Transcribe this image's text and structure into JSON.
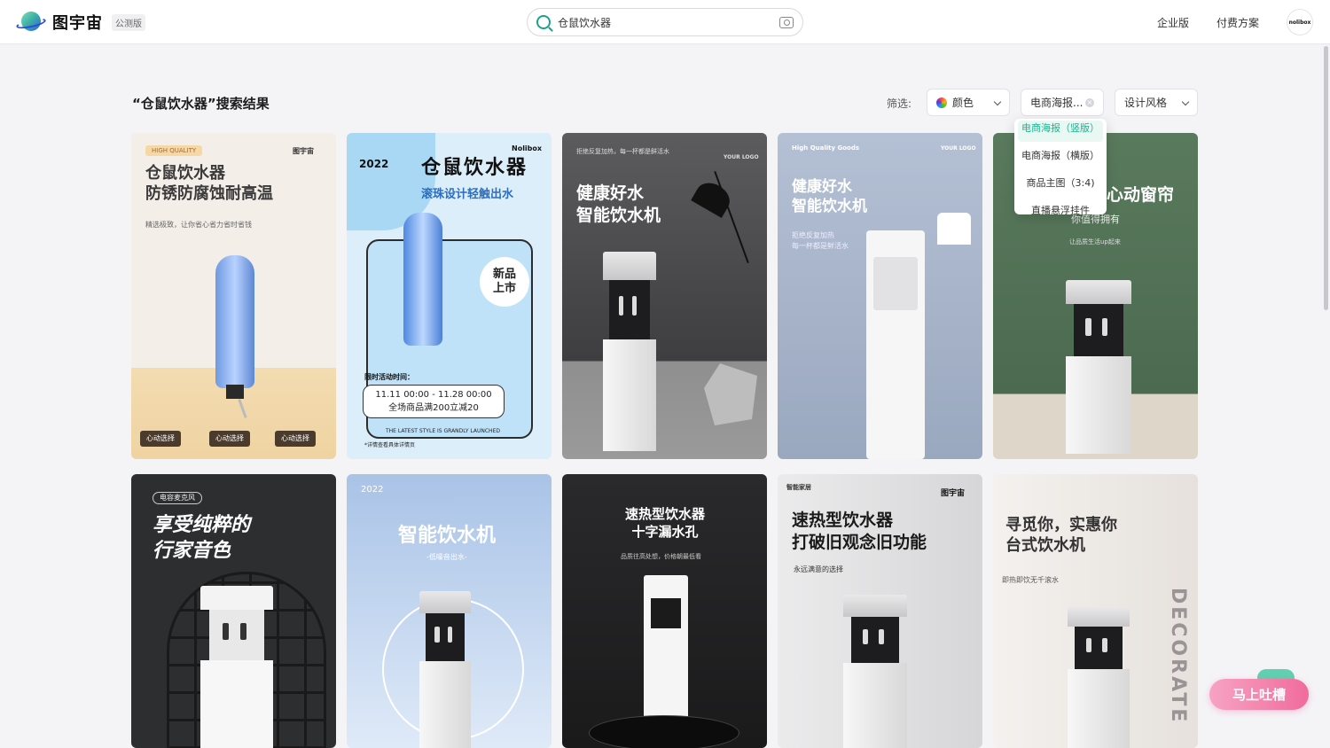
{
  "header": {
    "logo_text": "图宇宙",
    "badge": "公测版",
    "search_value": "仓鼠饮水器",
    "links": [
      "企业版",
      "付费方案"
    ],
    "avatar_text": "nolibox"
  },
  "results": {
    "title": "“仓鼠饮水器”搜索结果",
    "filter_label": "筛选:",
    "filters": {
      "color": "颜色",
      "type": "电商海报...",
      "style": "设计风格"
    },
    "dropdown": [
      "电商海报（竖版）",
      "电商海报（横版）",
      "商品主图（3:4)",
      "直播悬浮挂件"
    ]
  },
  "cards": [
    {
      "tag": "HIGH QUALITY",
      "brand": "图宇宙",
      "title": "仓鼠饮水器\n防锈防腐蚀耐高温",
      "sub": "精选极致，让你省心省力省时省钱",
      "pills": [
        "心动选择",
        "心动选择",
        "心动选择"
      ]
    },
    {
      "badge": "2022",
      "brand": "Nolibox",
      "title": "仓鼠饮水器",
      "subtitle": "滚珠设计轻触出水",
      "new_label": "新品\n上市",
      "activity_label": "限时活动时间：",
      "activity": "11.11 00:00 - 11.28 00:00\n全场商品满200立减20",
      "footer": "THE LATEST STYLE IS GRANDLY LAUNCHED",
      "note": "*详情查看具体详情页"
    },
    {
      "small": "拒绝反复加热，每一杯都是鲜活水",
      "logo": "YOUR LOGO",
      "title": "健康好水\n智能饮水机"
    },
    {
      "small": "High Quality Goods",
      "logo": "YOUR LOGO",
      "title": "健康好水\n智能饮水机",
      "sub": "拒绝反复加热\n每一杯都是鲜活水"
    },
    {
      "title": "心动窗帘",
      "sub1": "你值得拥有",
      "sub2": "让品质生活up起来"
    },
    {
      "tag": "电容麦克风",
      "title": "享受纯粹的\n行家音色"
    },
    {
      "year": "2022",
      "title": "智能饮水机",
      "sub": "-低噪音出水-"
    },
    {
      "title": "速热型饮水器\n十字漏水孔",
      "sub": "品质往高处想，价格朝最低看"
    },
    {
      "tag": "智能家居",
      "brand": "图宇宙",
      "title": "速热型饮水器\n打破旧观念旧功能",
      "sub": "永远满意的选择"
    },
    {
      "title": "寻觅你，实惠你\n台式饮水机",
      "sub": "即热即饮无千滚水",
      "side_text": "DECORATE"
    }
  ],
  "feedback": "马上吐槽"
}
